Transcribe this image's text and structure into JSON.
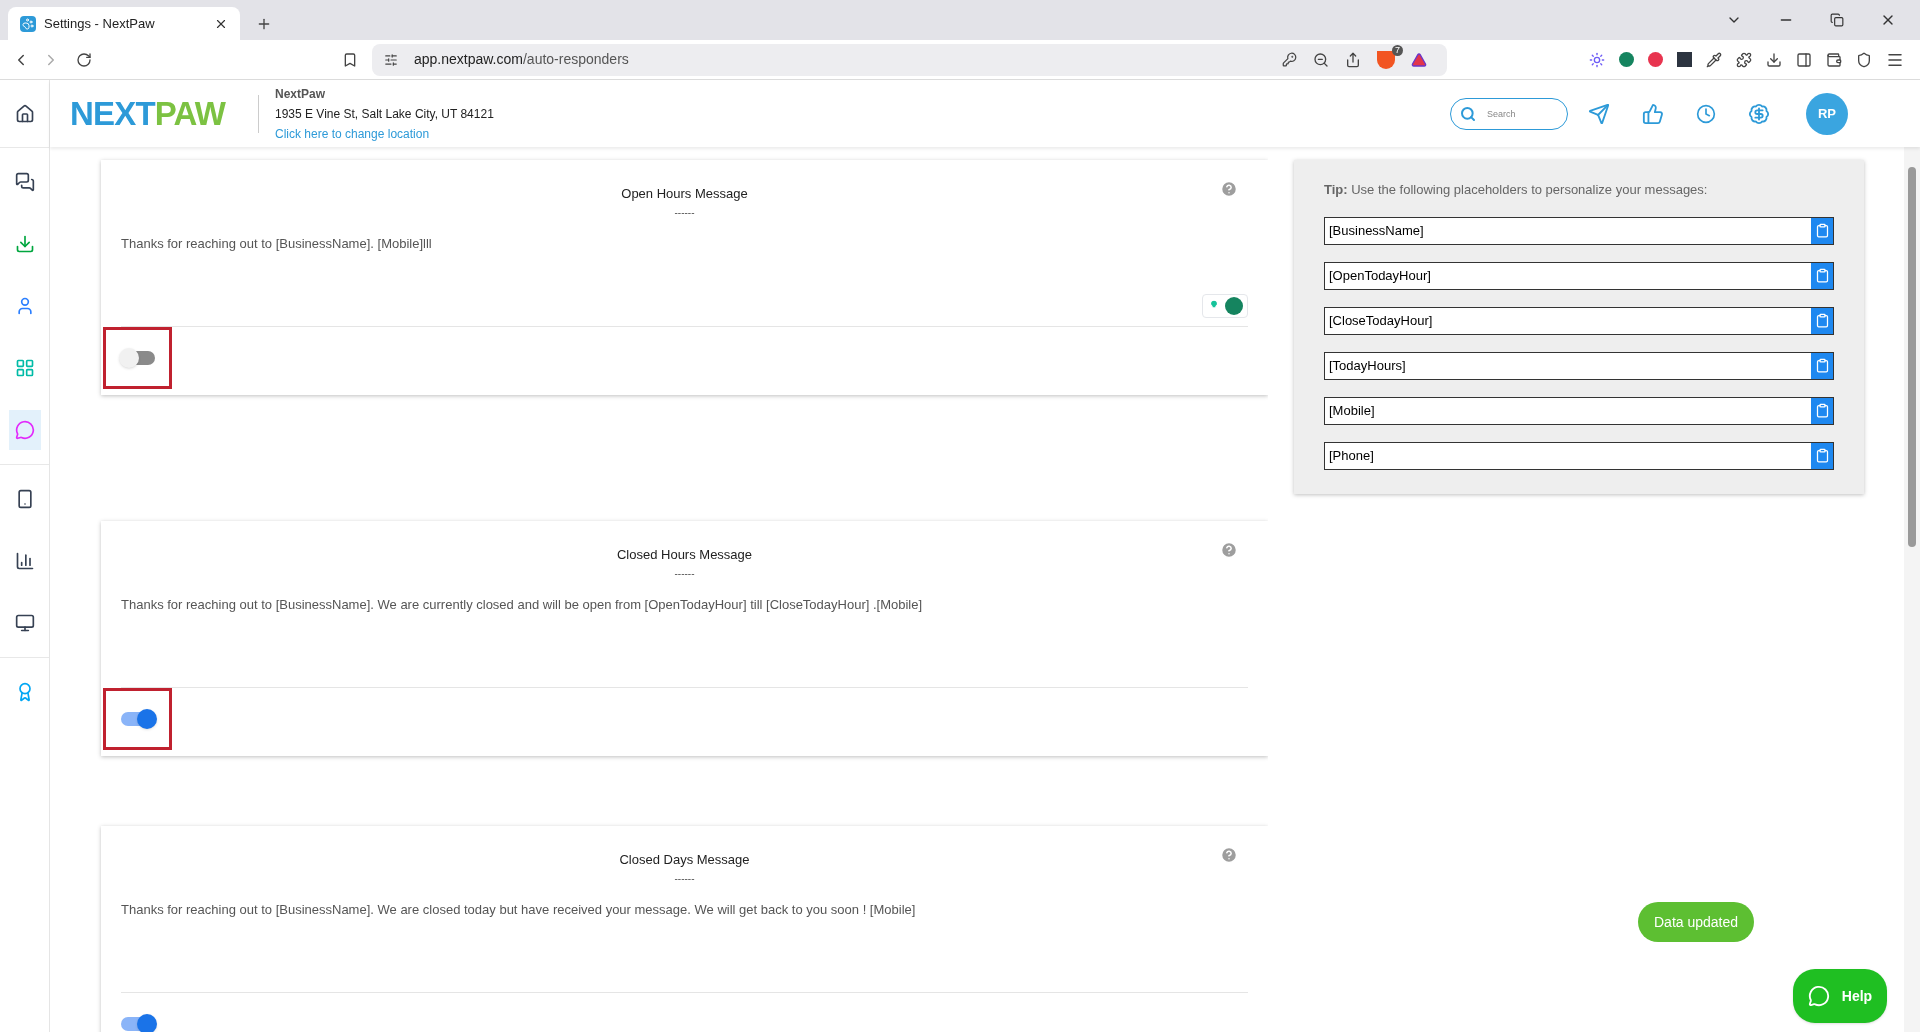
{
  "browser": {
    "tab_title": "Settings - NextPaw",
    "url_host": "app.nextpaw.com",
    "url_path": "/auto-responders",
    "shield_badge": "7"
  },
  "header": {
    "logo": {
      "first": "NEXT",
      "second": "PAW"
    },
    "business": "NextPaw",
    "address": "1935 E Vine St, Salt Lake City, UT 84121",
    "change_link": "Click here to change location",
    "search": {
      "placeholder": "Search"
    },
    "avatar": "RP"
  },
  "sidebar": {
    "groups": [
      [
        {
          "selected": false
        }
      ],
      [
        {
          "selected": false
        },
        {
          "selected": false
        },
        {
          "selected": false
        },
        {
          "selected": false
        },
        {
          "selected": true
        }
      ],
      [
        {
          "selected": false
        },
        {
          "selected": false
        },
        {
          "selected": false
        }
      ],
      [
        {
          "selected": false
        }
      ]
    ]
  },
  "messages": [
    {
      "title": "Open Hours Message",
      "rule": "------",
      "text": "Thanks for reaching out to [BusinessName]. [Mobile]lll",
      "on": false,
      "highlighted": true,
      "grammar_widget": true
    },
    {
      "title": "Closed Hours Message",
      "rule": "------",
      "text": "Thanks for reaching out to [BusinessName]. We are currently closed and will be open from [OpenTodayHour] till [CloseTodayHour] .[Mobile]",
      "on": true,
      "highlighted": true,
      "grammar_widget": false
    },
    {
      "title": "Closed Days Message",
      "rule": "------",
      "text": "Thanks for reaching out to [BusinessName]. We are closed today but have received your message. We will get back to you soon ! [Mobile]",
      "on": true,
      "highlighted": false,
      "grammar_widget": false
    }
  ],
  "tip": {
    "text": "**Tip:** Use the following placeholders to personalize your messages:",
    "fields": [
      {
        "value": "[BusinessName]"
      },
      {
        "value": "[OpenTodayHour]"
      },
      {
        "value": "[CloseTodayHour]"
      },
      {
        "value": "[TodayHours]"
      },
      {
        "value": "[Mobile]"
      },
      {
        "value": "[Phone]"
      }
    ]
  },
  "toast": "Data updated",
  "help_button": "Help"
}
